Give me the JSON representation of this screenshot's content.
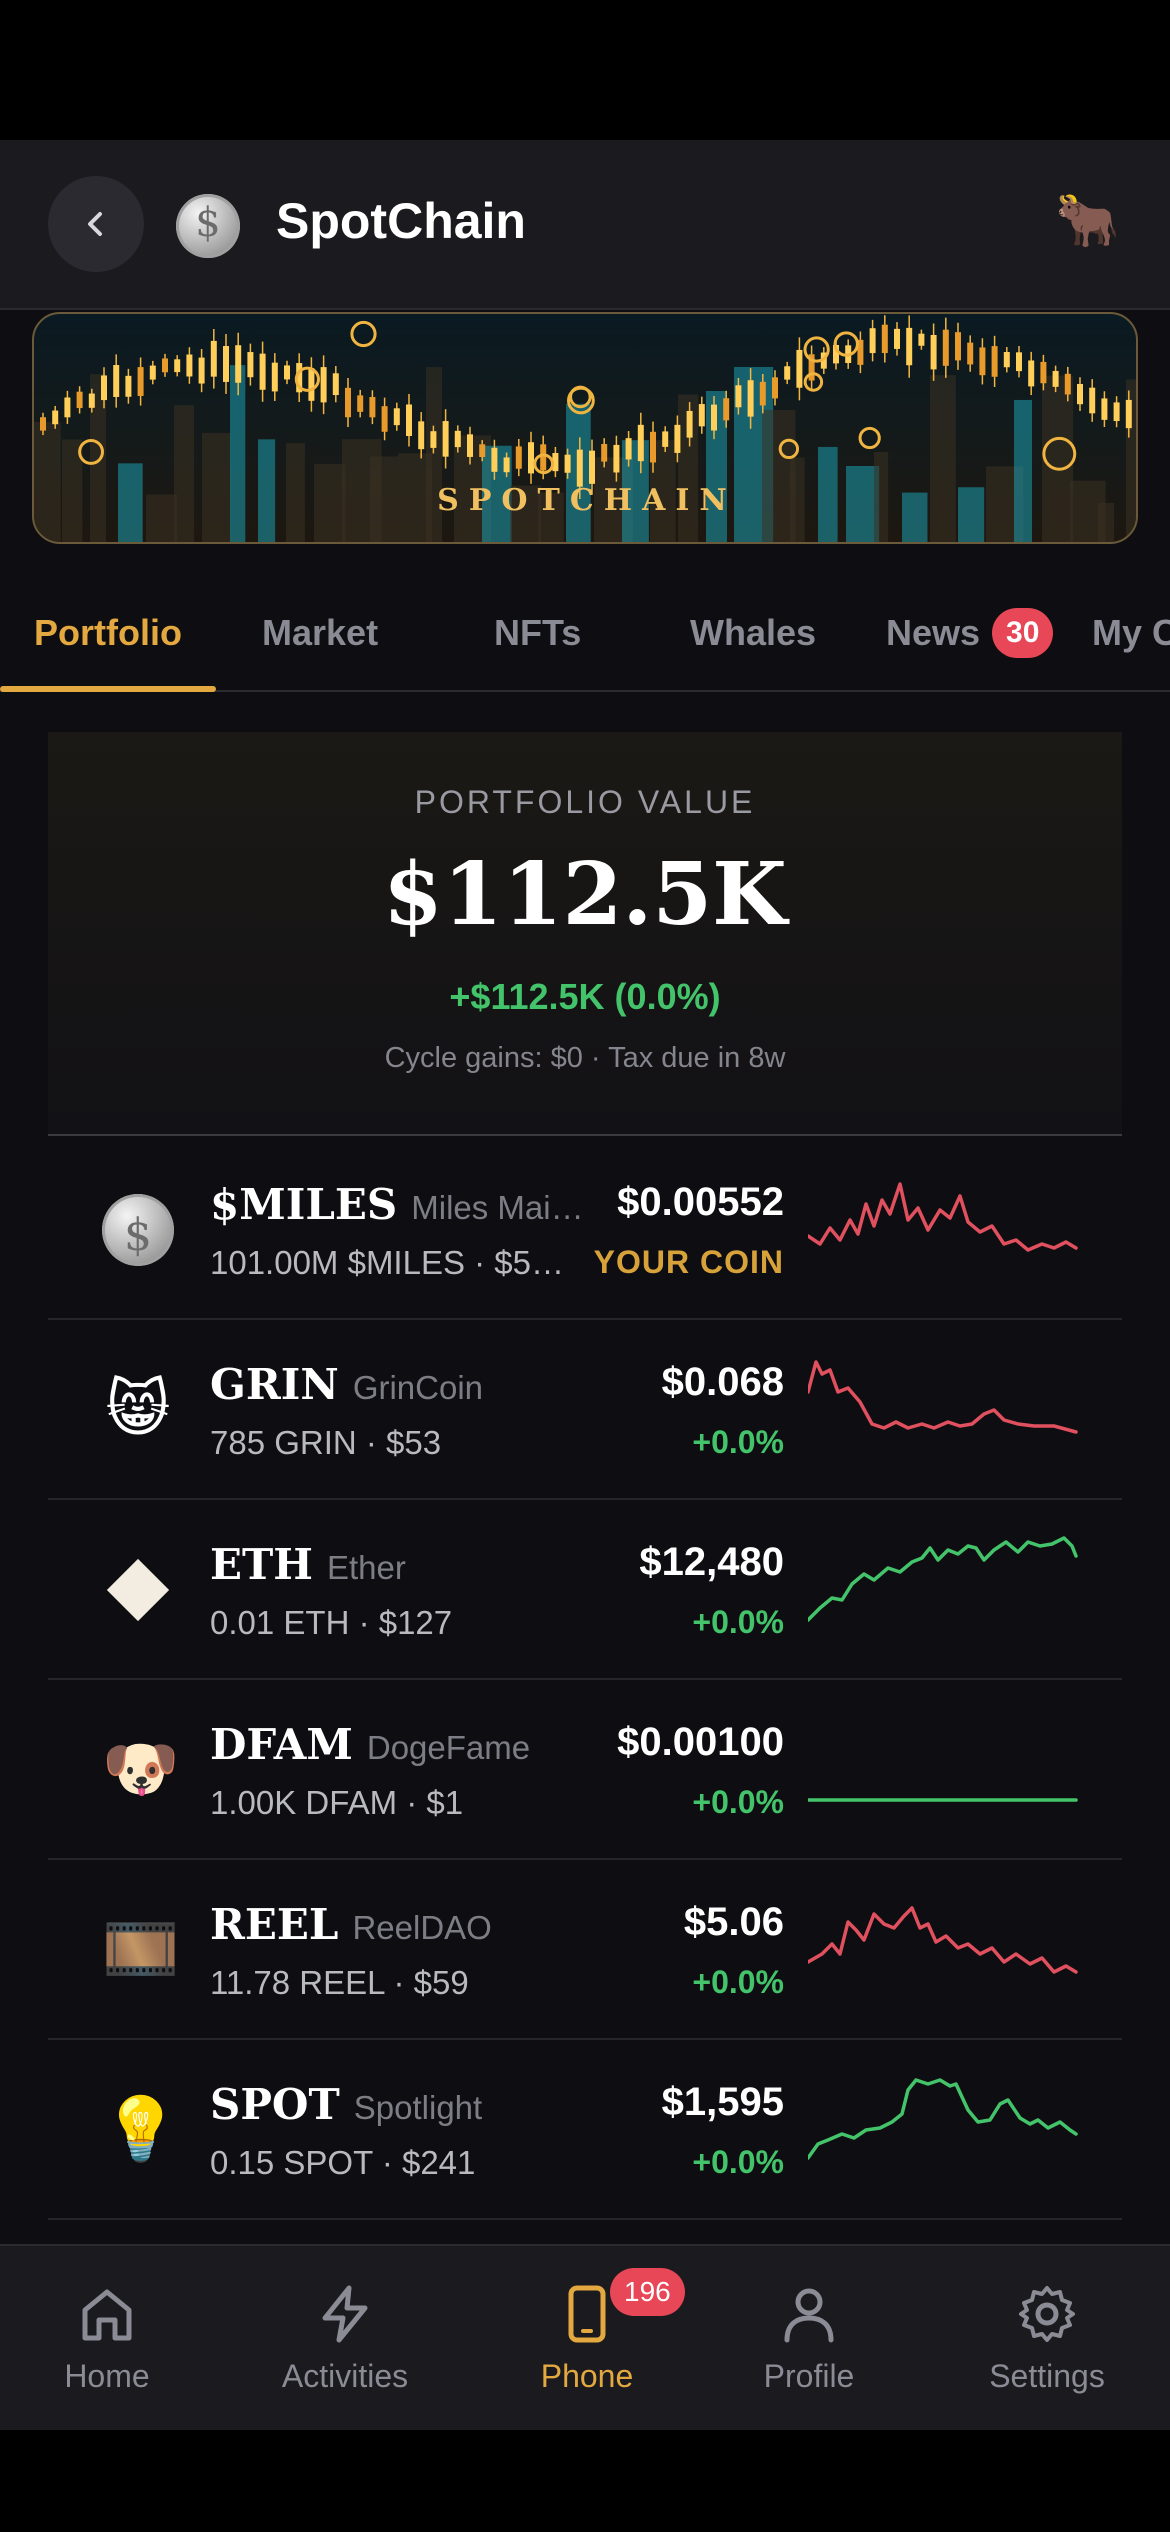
{
  "header": {
    "title": "SpotChain",
    "bull_icon": "🐂"
  },
  "banner": {
    "text": "SPOTCHAIN"
  },
  "tabs": [
    {
      "label": "Portfolio",
      "active": true
    },
    {
      "label": "Market"
    },
    {
      "label": "NFTs"
    },
    {
      "label": "Whales"
    },
    {
      "label": "News",
      "badge": "30"
    },
    {
      "label": "My C"
    }
  ],
  "portfolio": {
    "label": "PORTFOLIO VALUE",
    "value": "$112.5K",
    "change": "+$112.5K (0.0%)",
    "sub": "Cycle gains: $0 · Tax due in 8w"
  },
  "coins": [
    {
      "symbol": "$MILES",
      "name": "Miles Mai…",
      "holding": "101.00M $MILES · $5…",
      "price": "$0.00552",
      "change": "YOUR COIN",
      "icon": "silver-coin-icon",
      "trend": "down",
      "color": "#e0505e"
    },
    {
      "symbol": "GRIN",
      "name": "GrinCoin",
      "holding": "785 GRIN · $53",
      "price": "$0.068",
      "change": "+0.0%",
      "icon": "😸",
      "trend": "down",
      "color": "#e0505e"
    },
    {
      "symbol": "ETH",
      "name": "Ether",
      "holding": "0.01 ETH · $127",
      "price": "$12,480",
      "change": "+0.0%",
      "icon": "diamond-icon",
      "trend": "up",
      "color": "#44c46a"
    },
    {
      "symbol": "DFAM",
      "name": "DogeFame",
      "holding": "1.00K DFAM · $1",
      "price": "$0.00100",
      "change": "+0.0%",
      "icon": "🐶",
      "trend": "flat",
      "color": "#44c46a"
    },
    {
      "symbol": "REEL",
      "name": "ReelDAO",
      "holding": "11.78 REEL · $59",
      "price": "$5.06",
      "change": "+0.0%",
      "icon": "🎞️",
      "trend": "down",
      "color": "#e0505e"
    },
    {
      "symbol": "SPOT",
      "name": "Spotlight",
      "holding": "0.15 SPOT · $241",
      "price": "$1,595",
      "change": "+0.0%",
      "icon": "💡",
      "trend": "up",
      "color": "#44c46a"
    }
  ],
  "nav": [
    {
      "label": "Home",
      "icon": "home-icon"
    },
    {
      "label": "Activities",
      "icon": "bolt-icon"
    },
    {
      "label": "Phone",
      "icon": "phone-icon",
      "badge": "196",
      "active": true
    },
    {
      "label": "Profile",
      "icon": "person-icon"
    },
    {
      "label": "Settings",
      "icon": "gear-icon"
    }
  ],
  "colors": {
    "accent": "#e3a83f",
    "up": "#44c46a",
    "down": "#e0505e",
    "badge": "#e84757"
  }
}
